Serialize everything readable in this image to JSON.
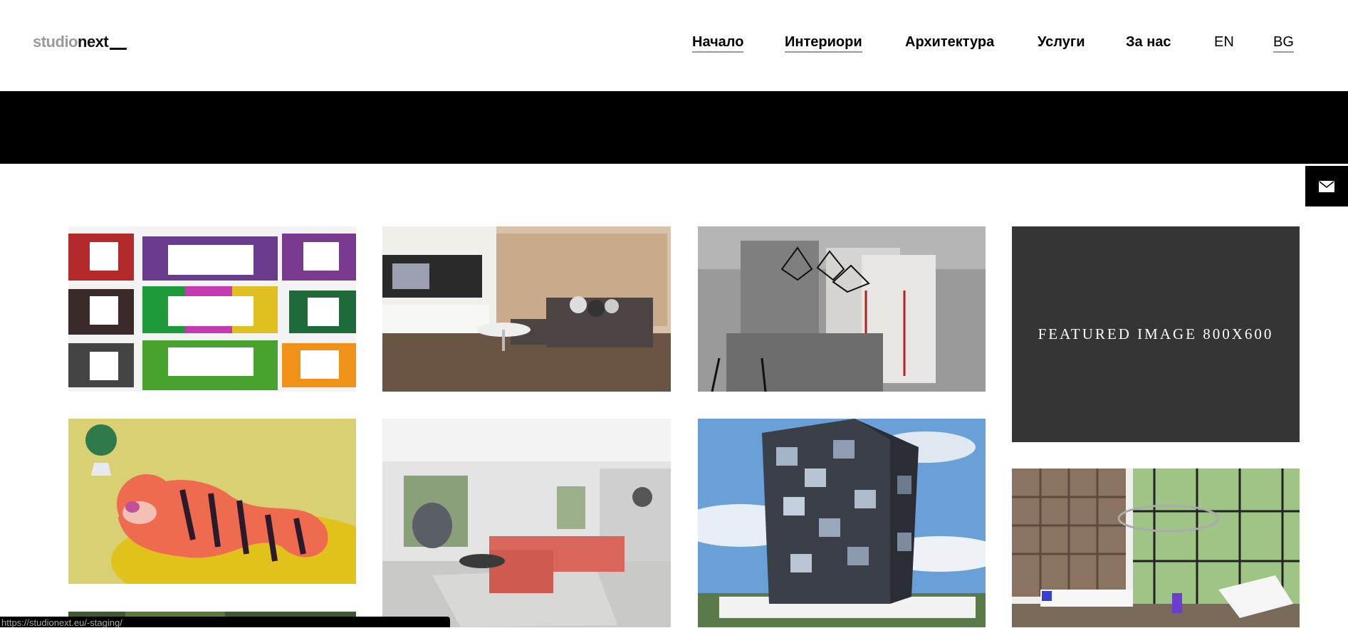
{
  "logo": {
    "studio": "studio",
    "next": "next"
  },
  "nav": {
    "items": [
      {
        "label": "Начало"
      },
      {
        "label": "Интериори"
      },
      {
        "label": "Архитектура"
      },
      {
        "label": "Услуги"
      },
      {
        "label": "За нас"
      }
    ],
    "lang_en": "EN",
    "lang_bg": "BG"
  },
  "gallery": {
    "featured_placeholder": "FEATURED IMAGE 800X600"
  },
  "status_url": "https://studionext.eu/-staging/",
  "colors": {
    "header_bg": "#ffffff",
    "banner_bg": "#000000",
    "featured_bg": "#353535",
    "underline": "#9a9a9a"
  },
  "icons": {
    "contact": "envelope-icon"
  }
}
